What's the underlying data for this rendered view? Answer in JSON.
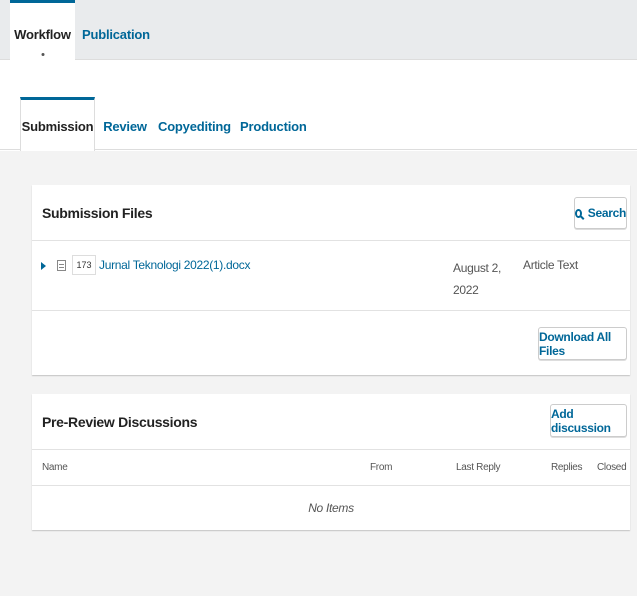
{
  "top_tabs": [
    {
      "label": "Workflow",
      "active": true
    },
    {
      "label": "Publication",
      "active": false
    }
  ],
  "sub_tabs": [
    {
      "label": "Submission",
      "active": true
    },
    {
      "label": "Review",
      "active": false
    },
    {
      "label": "Copyediting",
      "active": false
    },
    {
      "label": "Production",
      "active": false
    }
  ],
  "submission_files": {
    "title": "Submission Files",
    "search_label": "Search",
    "files": [
      {
        "id": "173",
        "name": "Jurnal Teknologi 2022(1).docx",
        "date": "August 2, 2022",
        "type": "Article Text"
      }
    ],
    "download_all_label": "Download All Files"
  },
  "discussions": {
    "title": "Pre-Review Discussions",
    "add_label": "Add discussion",
    "columns": [
      "Name",
      "From",
      "Last Reply",
      "Replies",
      "Closed"
    ],
    "empty_text": "No Items"
  },
  "colors": {
    "accent": "#006798",
    "background": "#f3f3f3"
  }
}
